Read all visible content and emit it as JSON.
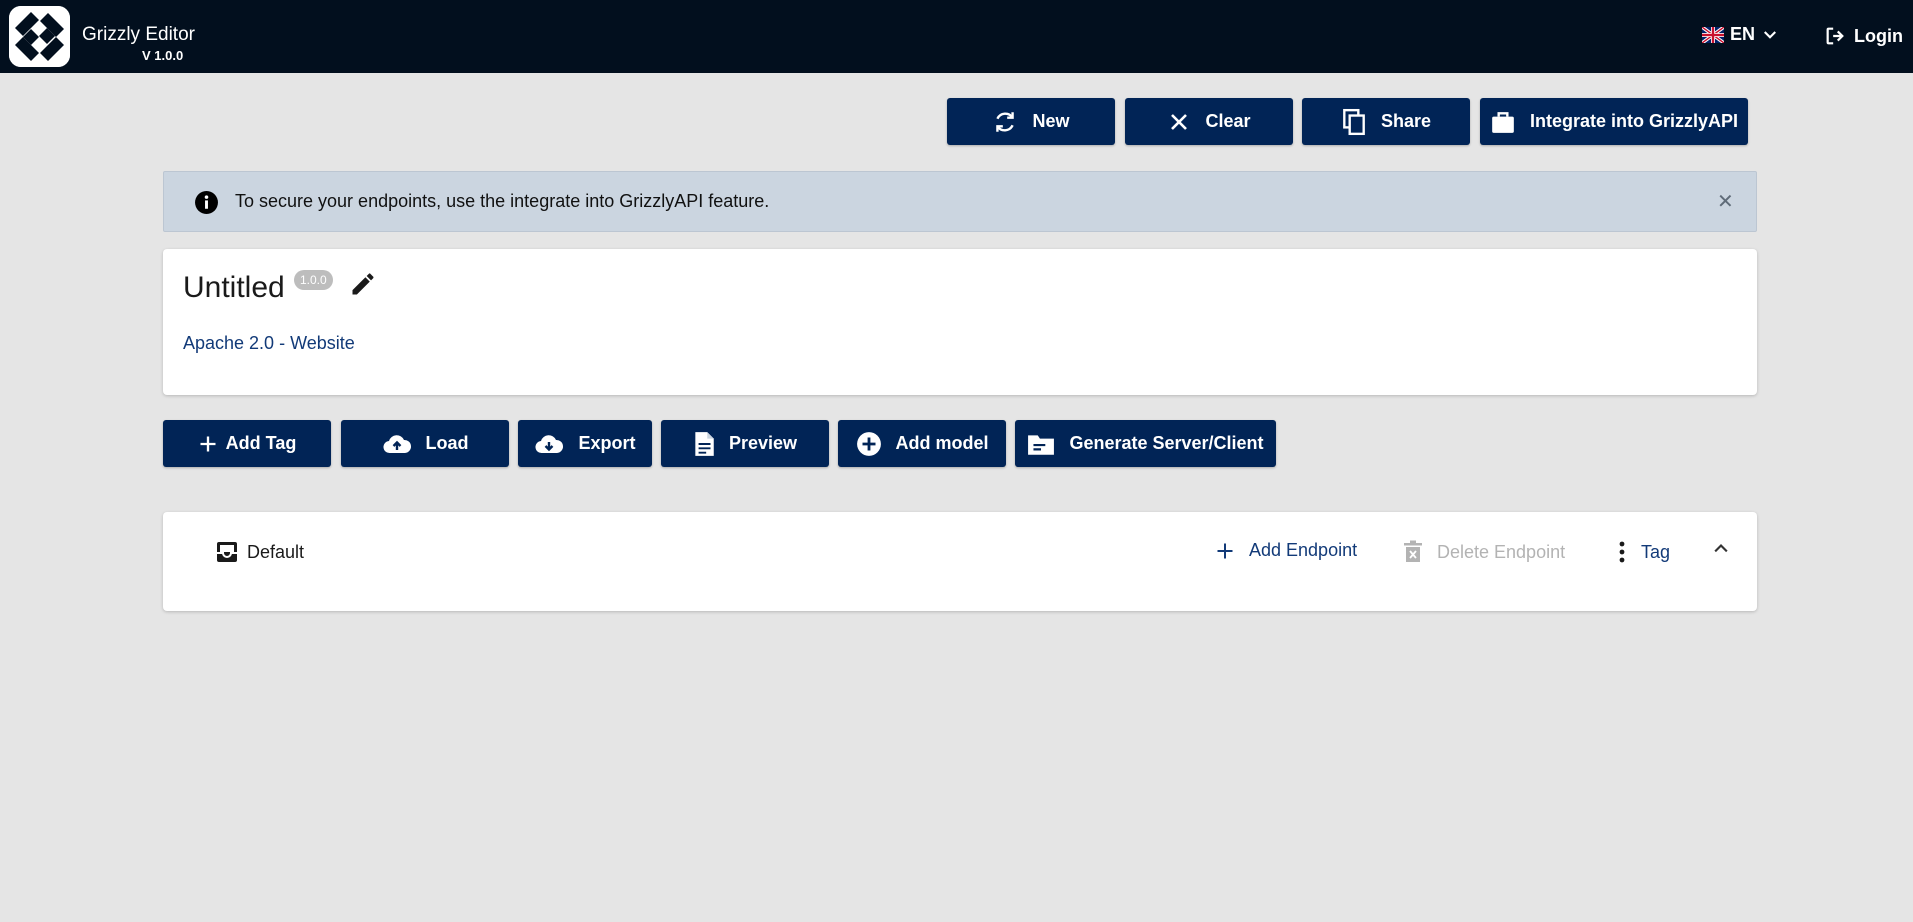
{
  "header": {
    "app_title": "Grizzly Editor",
    "version": "V 1.0.0",
    "language": "EN",
    "login_label": "Login"
  },
  "toolbar": {
    "new_label": "New",
    "clear_label": "Clear",
    "share_label": "Share",
    "integrate_label": "Integrate into GrizzlyAPI"
  },
  "alert": {
    "message": "To secure your endpoints, use the integrate into GrizzlyAPI feature.",
    "close_symbol": "✕"
  },
  "document": {
    "title": "Untitled",
    "version": "1.0.0",
    "license_link": "Apache 2.0 - Website"
  },
  "actions": {
    "add_tag_label": "Add Tag",
    "load_label": "Load",
    "export_label": "Export",
    "preview_label": "Preview",
    "add_model_label": "Add model",
    "generate_label": "Generate Server/Client"
  },
  "tag_panel": {
    "name": "Default",
    "add_endpoint_label": "Add Endpoint",
    "delete_endpoint_label": "Delete Endpoint",
    "tag_label": "Tag"
  },
  "colors": {
    "header_bg": "#020f1e",
    "button_bg": "#012456",
    "page_bg": "#e5e5e5",
    "alert_bg": "#cbd5e0",
    "link": "#123a78",
    "disabled": "#b3b3b3"
  },
  "icons": {
    "logo": "grizzly-logo-icon",
    "flag": "uk-flag-icon",
    "language_dropdown": "chevron-down-icon",
    "login": "login-icon",
    "new": "refresh-icon",
    "clear": "close-icon",
    "share": "copy-icon",
    "integrate": "briefcase-icon",
    "alert": "info-icon",
    "edit": "pencil-icon",
    "add_tag": "plus-icon",
    "load": "cloud-upload-icon",
    "export": "cloud-download-icon",
    "preview": "document-icon",
    "add_model": "plus-circle-icon",
    "generate": "folder-icon",
    "tag": "inbox-icon",
    "add_endpoint": "plus-icon",
    "delete_endpoint": "trash-icon",
    "tag_menu": "more-vertical-icon",
    "collapse": "chevron-up-icon"
  }
}
